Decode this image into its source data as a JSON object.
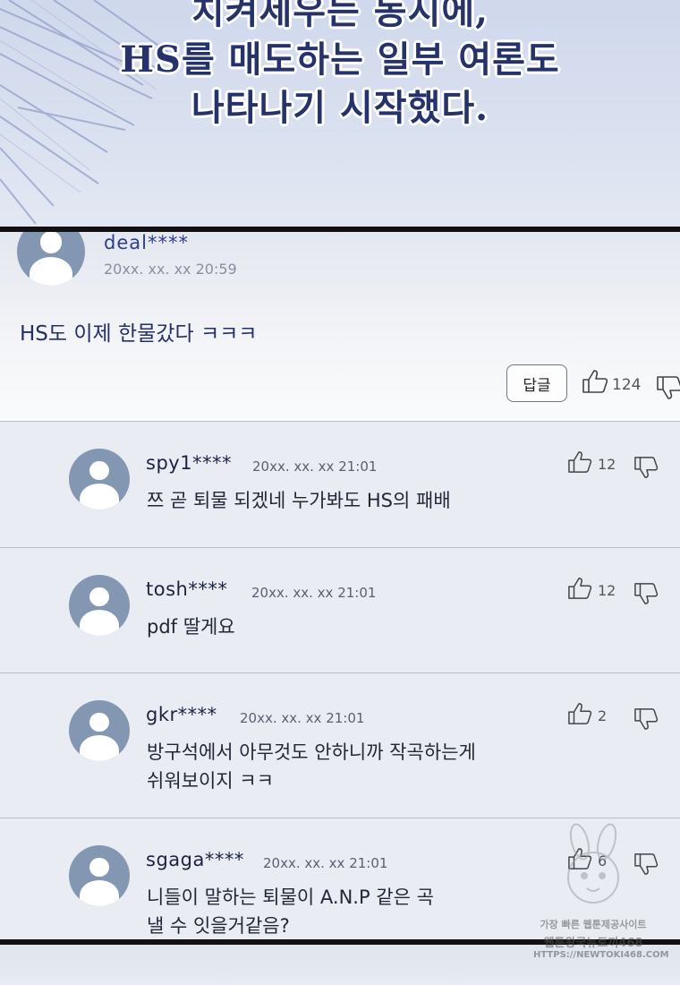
{
  "narration": {
    "lines": [
      "치켜세우는 동시에,",
      "HS를 매도하는 일부 여론도",
      "나타나기 시작했다."
    ]
  },
  "top_comment": {
    "username": "deal****",
    "timestamp": "20xx. xx. xx  20:59",
    "content": "HS도 이제 한물갔다 ㅋㅋㅋ",
    "reply_label": "답글",
    "like_count": "124",
    "icons": {
      "avatar": "user-avatar",
      "like": "thumbs-up-icon",
      "dislike": "thumbs-down-icon"
    }
  },
  "replies": [
    {
      "username": "spy1****",
      "timestamp": "20xx. xx. xx  21:01",
      "content": [
        "쯔 곧 퇴물 되겠네 누가봐도 HS의 패배"
      ],
      "like_count": "12"
    },
    {
      "username": "tosh****",
      "timestamp": "20xx. xx. xx  21:01",
      "content": [
        "pdf 딸게요"
      ],
      "like_count": "12"
    },
    {
      "username": "gkr****",
      "timestamp": "20xx. xx. xx  21:01",
      "content": [
        "방구석에서 아무것도 안하니까 작곡하는게",
        "쉬워보이지 ㅋㅋ"
      ],
      "like_count": "2"
    },
    {
      "username": "sgaga****",
      "timestamp": "20xx. xx. xx  21:01",
      "content": [
        "니들이 말하는 퇴물이 A.N.P 같은 곡",
        "낼 수 잇을거같음?"
      ],
      "like_count": "6"
    }
  ],
  "watermark": {
    "line1": "가장 빠른 웹툰제공사이트",
    "line2": "웹툰왕국뉴토끼468",
    "line3": "HTTPS://NEWTOKI468.COM"
  },
  "colors": {
    "username_top": "#2f3d8a",
    "narration_text": "#26336a",
    "avatar_bg": "#8497b2",
    "panel_border": "#111111"
  }
}
